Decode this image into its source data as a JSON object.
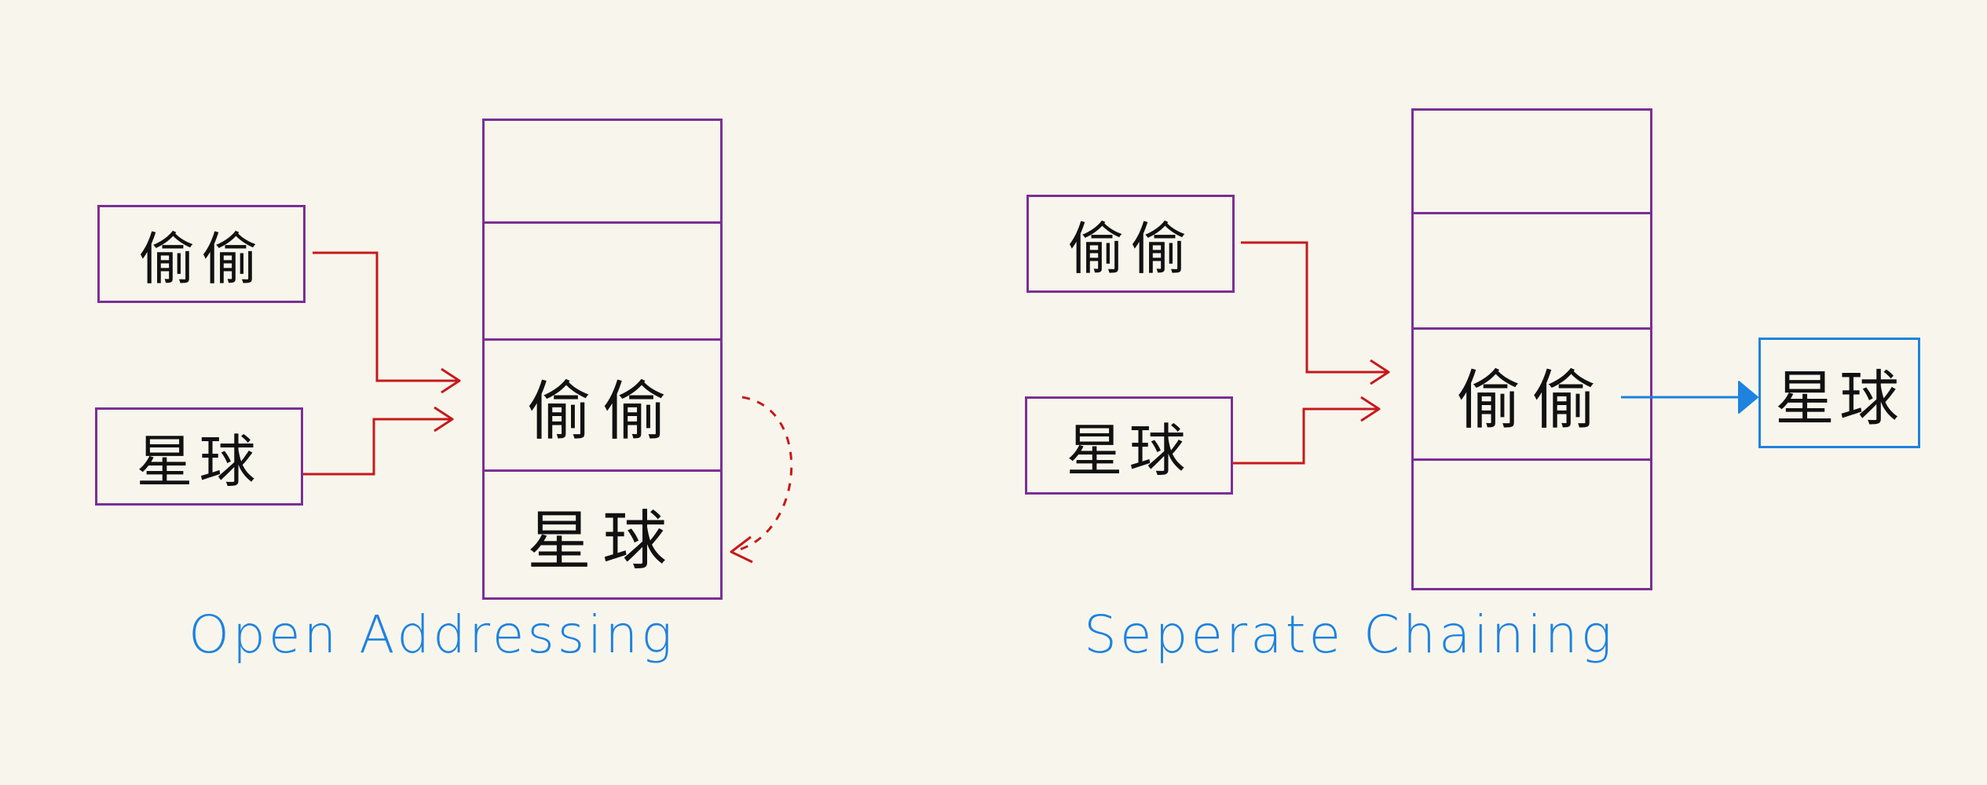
{
  "open_addressing": {
    "caption": "Open Addressing",
    "keys": [
      "偷偷",
      "星球"
    ],
    "table_slots": [
      "",
      "",
      "偷偷",
      "星球"
    ]
  },
  "separate_chaining": {
    "caption": "Seperate Chaining",
    "keys": [
      "偷偷",
      "星球"
    ],
    "table_slots": [
      "",
      "",
      "偷偷",
      ""
    ],
    "chain_node": "星球"
  },
  "colors": {
    "background": "#f8f6ec",
    "box_border": "#7a2f95",
    "arrow": "#c8181b",
    "caption": "#1e82e0",
    "chain": "#1e82e0"
  }
}
